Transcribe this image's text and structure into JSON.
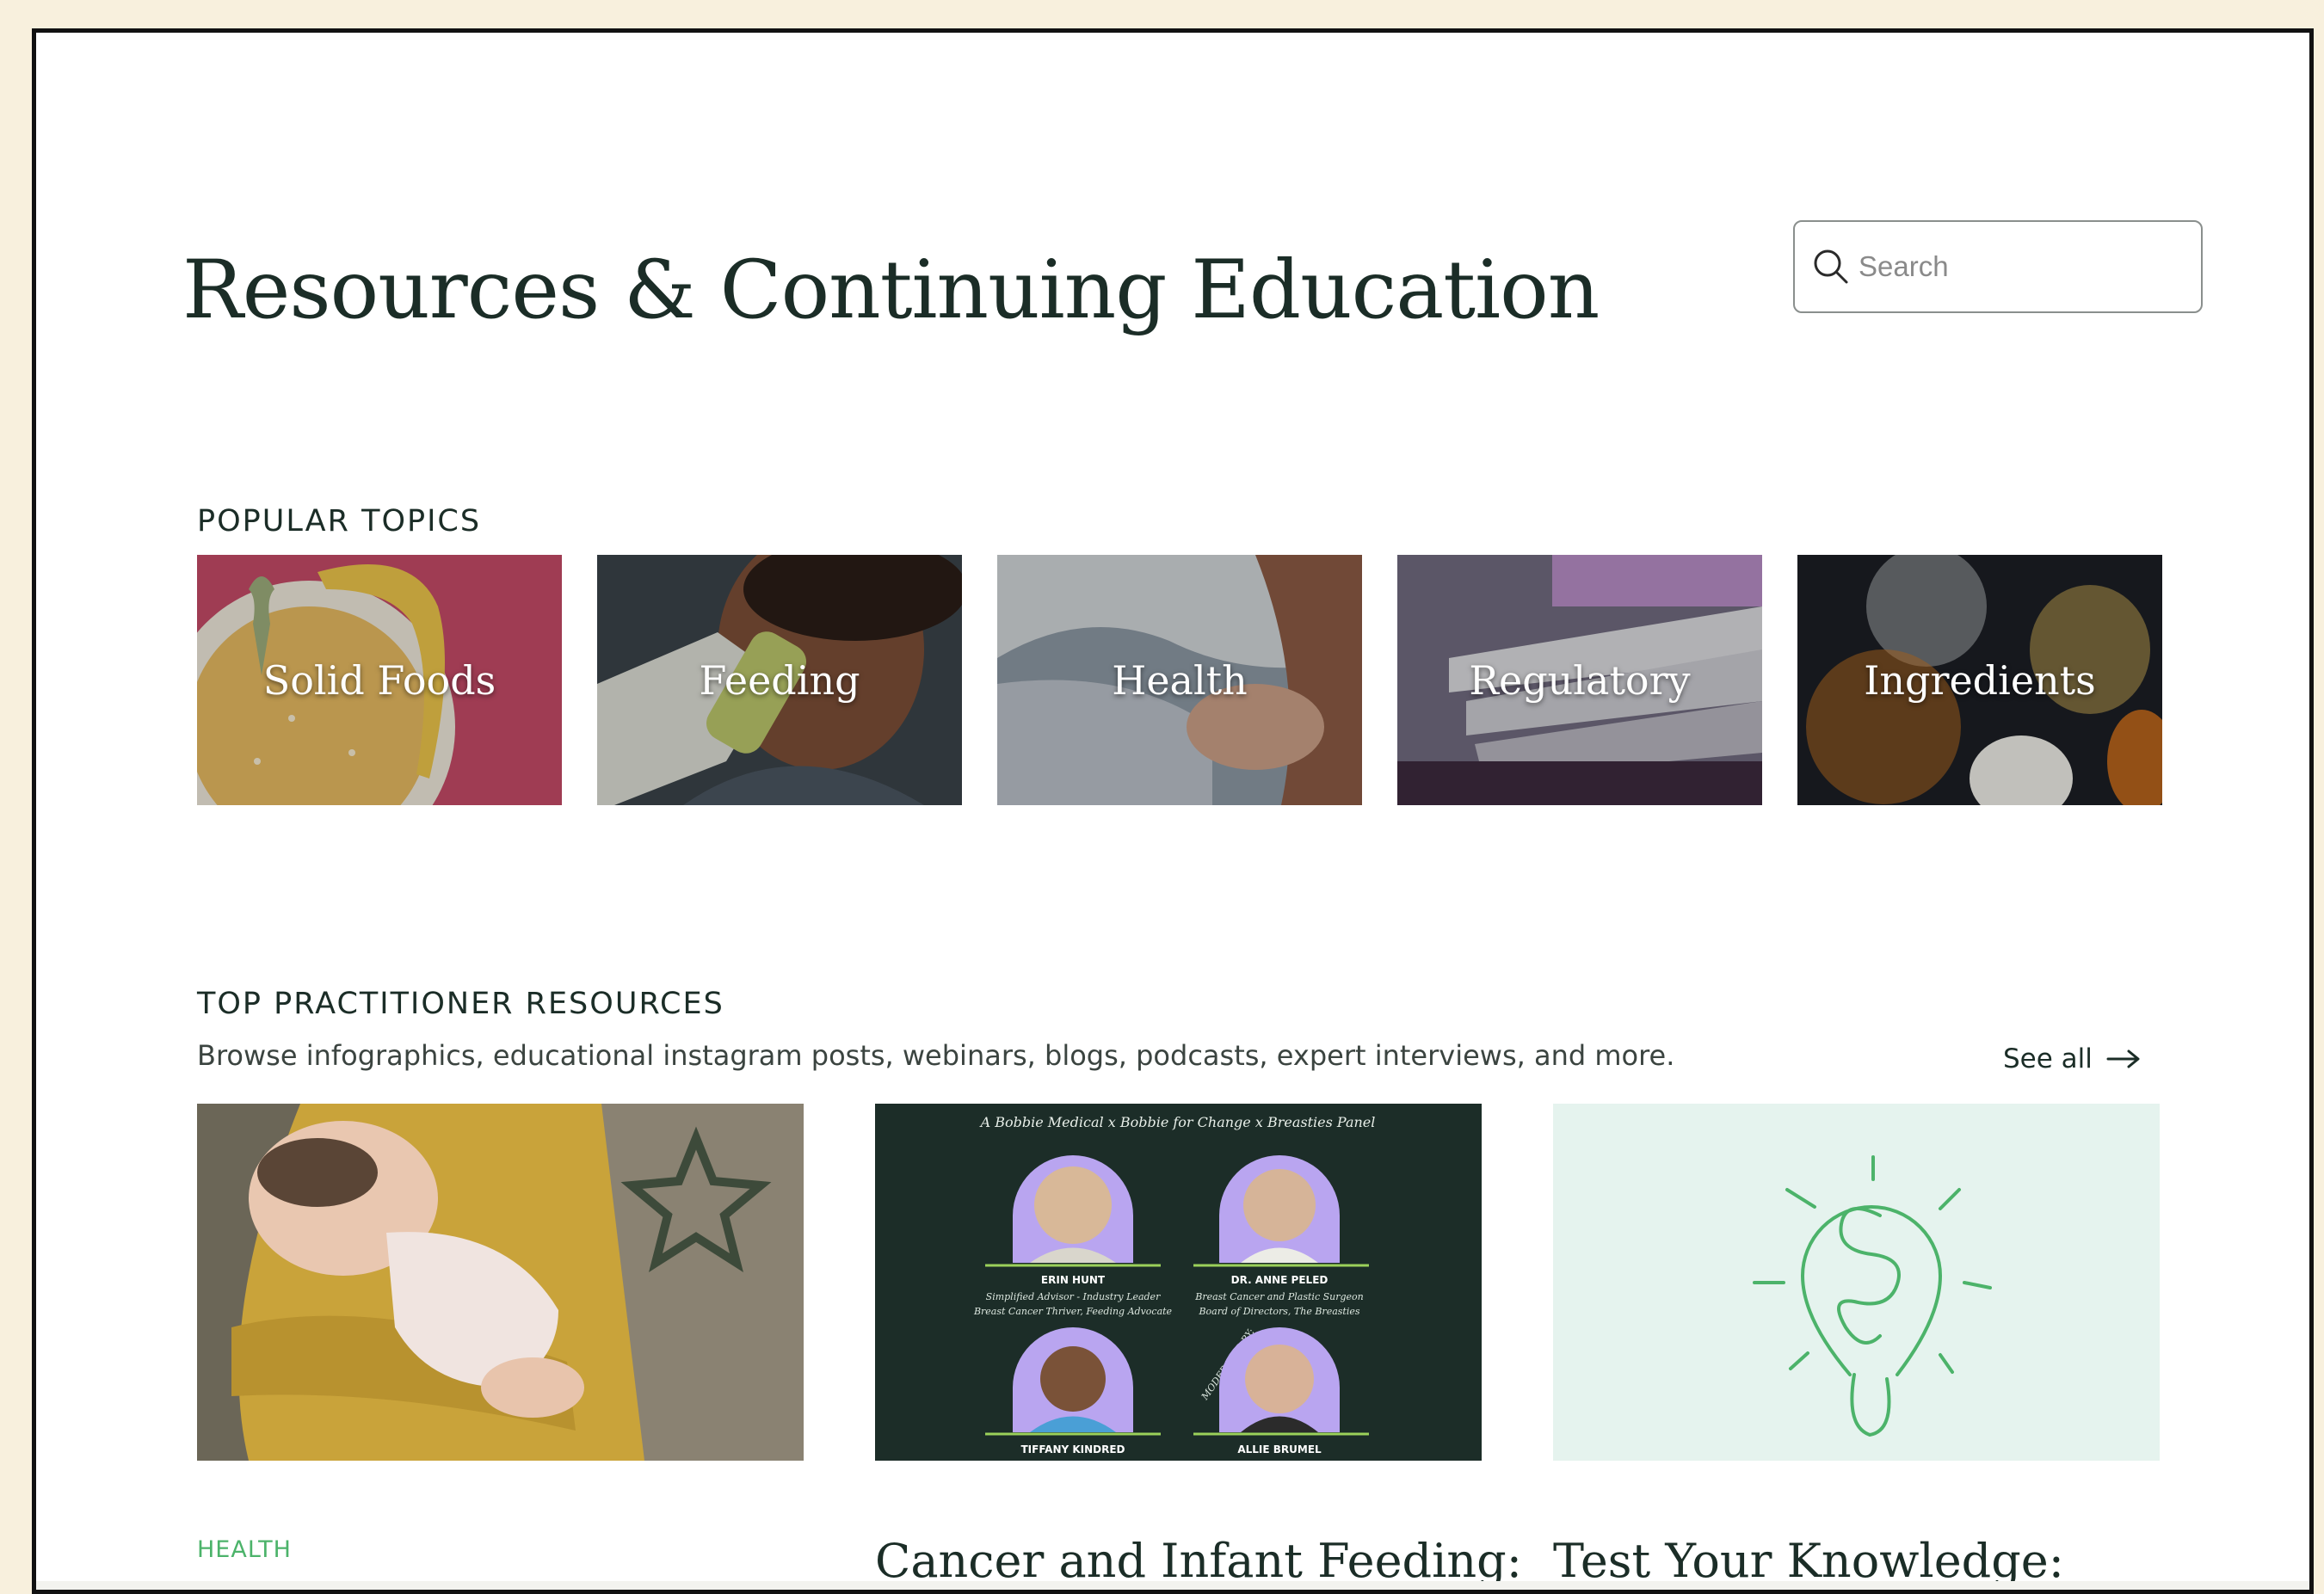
{
  "header": {
    "title": "Resources & Continuing Education",
    "search_placeholder": "Search"
  },
  "popular_topics": {
    "heading": "POPULAR TOPICS",
    "items": [
      {
        "label": "Solid Foods"
      },
      {
        "label": "Feeding"
      },
      {
        "label": "Health"
      },
      {
        "label": "Regulatory"
      },
      {
        "label": "Ingredients"
      }
    ]
  },
  "practitioner_resources": {
    "heading": "TOP PRACTITIONER RESOURCES",
    "description": "Browse infographics, educational instagram posts, webinars, blogs, podcasts, expert interviews, and more.",
    "see_all_label": "See all",
    "cards": [
      {
        "tag": "HEALTH",
        "title": ""
      },
      {
        "tag": "",
        "title": "Cancer and Infant Feeding:",
        "image": {
          "subtitle": "A Bobbie Medical x Bobbie for Change x Breasties Panel",
          "moderated_by": "MODERATED BY:",
          "people": [
            {
              "name": "ERIN HUNT",
              "line1": "Simplified Advisor - Industry Leader",
              "line2": "Breast Cancer Thriver, Feeding Advocate"
            },
            {
              "name": "DR. ANNE PELED",
              "line1": "Breast Cancer and Plastic Surgeon",
              "line2": "Board of Directors, The Breasties"
            },
            {
              "name": "TIFFANY KINDRED",
              "line1": "",
              "line2": ""
            },
            {
              "name": "ALLIE BRUMEL",
              "line1": "",
              "line2": ""
            }
          ]
        }
      },
      {
        "tag": "",
        "title": "Test Your Knowledge:"
      }
    ]
  },
  "colors": {
    "background": "#f8f0dd",
    "text_dark": "#1b2d27",
    "accent_green": "#4cb36a",
    "webinar_bg": "#1c2d28",
    "quiz_bg": "#e5f3ee"
  }
}
